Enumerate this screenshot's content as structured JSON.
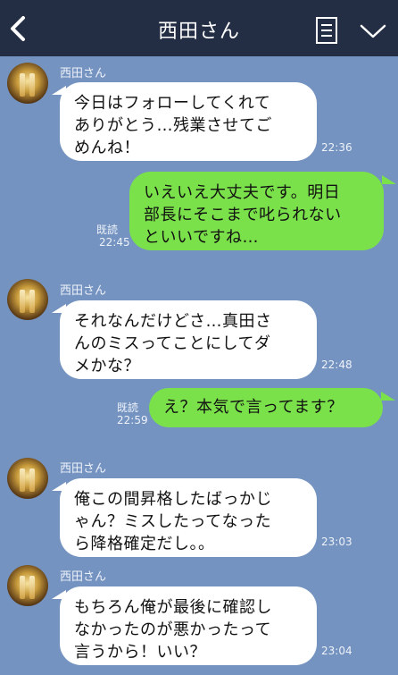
{
  "header": {
    "title": "西田さん",
    "back_icon": "chevron-left-icon",
    "menu_icon": "notes-icon",
    "collapse_icon": "chevron-down-icon",
    "bg_color": "#232d44"
  },
  "chat": {
    "bg_color": "#7493c0",
    "incoming_color": "#ffffff",
    "outgoing_color": "#7ae14b",
    "read_label": "既読",
    "messages": [
      {
        "from": "西田さん",
        "text": "今日はフォローしてくれて\nありがとう…残業させてご\nめんね！",
        "time": "22:36"
      },
      {
        "from": "me",
        "text": "いえいえ大丈夫です。明日\n部長にそこまで叱られない\nといいですね…",
        "time": "22:45",
        "read": "既読"
      },
      {
        "from": "西田さん",
        "text": "それなんだけどさ…真田さ\nんのミスってことにしてダ\nメかな？",
        "time": "22:48"
      },
      {
        "from": "me",
        "text": "え？本気で言ってます？",
        "time": "22:59",
        "read": "既読"
      },
      {
        "from": "西田さん",
        "text": "俺この間昇格したばっかじ\nゃん？ミスしたってなった\nら降格確定だし。。",
        "time": "23:03"
      },
      {
        "from": "西田さん",
        "text": "もちろん俺が最後に確認し\nなかったのが悪かったって\n言うから！いい？",
        "time": "23:04"
      }
    ]
  }
}
